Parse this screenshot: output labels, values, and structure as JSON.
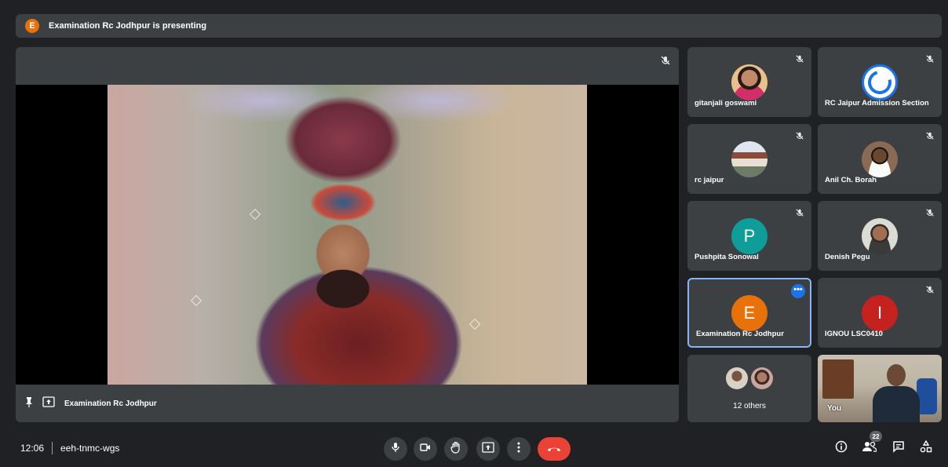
{
  "presenting_banner": {
    "badge_letter": "E",
    "text": "Examination Rc Jodhpur is presenting"
  },
  "main_tile": {
    "presenter_name": "Examination Rc Jodhpur"
  },
  "participants": [
    {
      "name": "gitanjali goswami",
      "avatar": "photo",
      "muted": true
    },
    {
      "name": "RC Jaipur Admission Section",
      "avatar": "logo",
      "muted": true
    },
    {
      "name": "rc jaipur",
      "avatar": "photo",
      "muted": true
    },
    {
      "name": "Anil Ch. Borah",
      "avatar": "photo",
      "muted": true
    },
    {
      "name": "Pushpita Sonowal",
      "avatar_letter": "P",
      "avatar_color": "#0f9d9a",
      "muted": true
    },
    {
      "name": "Denish Pegu",
      "avatar": "photo",
      "muted": true
    },
    {
      "name": "Examination Rc Jodhpur",
      "avatar_letter": "E",
      "avatar_color": "#e8710a",
      "active": true,
      "more_label": "•••"
    },
    {
      "name": "IGNOU LSC0410",
      "avatar_letter": "I",
      "avatar_color": "#c5221f",
      "muted": true
    }
  ],
  "others": {
    "label": "12 others"
  },
  "self_view": {
    "label": "You"
  },
  "meeting": {
    "time": "12:06",
    "code": "eeh-tnmc-wgs"
  },
  "controls": [
    "mic-icon",
    "camera-icon",
    "raise-hand-icon",
    "present-icon",
    "more-options-icon",
    "end-call-icon"
  ],
  "right_controls": {
    "people_count": "22"
  },
  "colors": {
    "background": "#202124",
    "tile": "#3c4043",
    "accent": "#8ab4f8",
    "end_call": "#ea4335"
  }
}
